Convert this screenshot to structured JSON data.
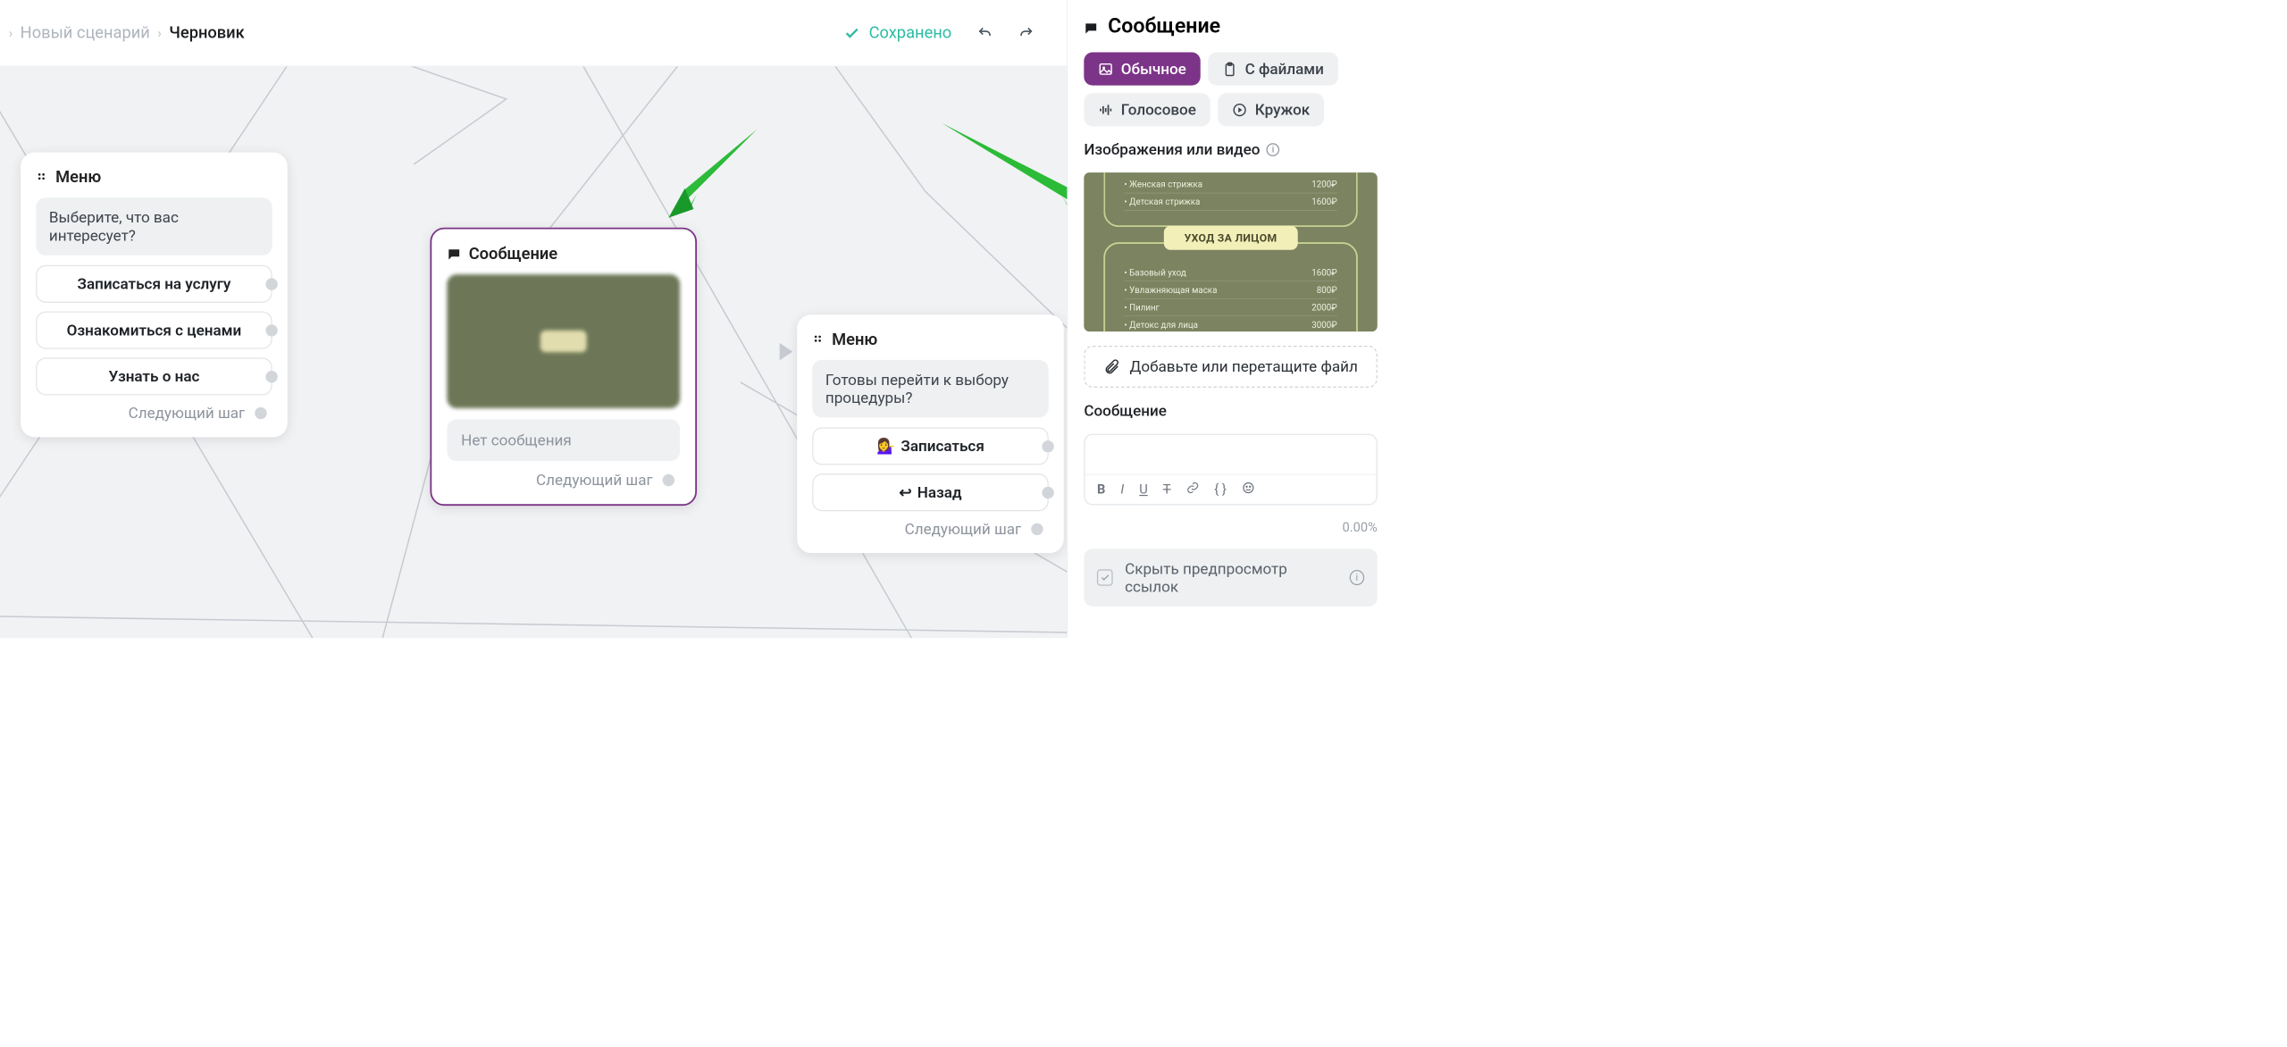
{
  "header": {
    "breadcrumb1": "Новый сценарий",
    "breadcrumb2": "Черновик",
    "saved_label": "Сохранено"
  },
  "canvas": {
    "next_step": "Следующий шаг",
    "node_menu": {
      "title": "Меню",
      "prompt": "Выберите, что вас интересует?",
      "options": [
        "Записаться на услугу",
        "Ознакомиться с ценами",
        "Узнать о нас"
      ]
    },
    "node_message": {
      "title": "Сообщение",
      "empty_text": "Нет сообщения"
    },
    "node_menu2": {
      "title": "Меню",
      "prompt": "Готовы перейти к выбору процедуры?",
      "opt1_emoji": "💁‍♀️",
      "opt1": "Записаться",
      "opt2_emoji": "↩",
      "opt2": "Назад"
    }
  },
  "sidebar": {
    "title": "Сообщение",
    "tabs": {
      "plain": "Обычное",
      "files": "С файлами",
      "voice": "Голосовое",
      "circle": "Кружок"
    },
    "media_label": "Изображения или видео",
    "pricelist": {
      "section1": [
        {
          "name": "Женская стрижка",
          "price": "1200₽"
        },
        {
          "name": "Детская стрижка",
          "price": "1600₽"
        }
      ],
      "section2_title": "УХОД ЗА ЛИЦОМ",
      "section2": [
        {
          "name": "Базовый уход",
          "price": "1600₽"
        },
        {
          "name": "Увлажняющая маска",
          "price": "800₽"
        },
        {
          "name": "Пилинг",
          "price": "2000₽"
        },
        {
          "name": "Детокс для лица",
          "price": "3000₽"
        }
      ]
    },
    "dropzone": "Добавьте или перетащите файл",
    "message_heading": "Сообщение",
    "counter": "0.00%",
    "hide_preview": "Скрыть предпросмотр ссылок"
  }
}
